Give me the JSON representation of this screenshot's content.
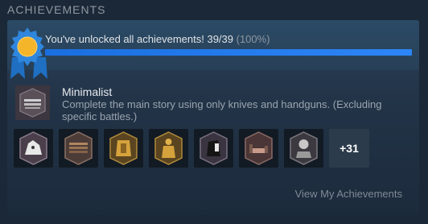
{
  "section": {
    "title": "ACHIEVEMENTS"
  },
  "progress": {
    "text": "You've unlocked all achievements! 39/39",
    "percent_label": "(100%)",
    "unlocked": 39,
    "total": 39,
    "fraction": 1.0,
    "bar_color": "#2d86f7"
  },
  "featured": {
    "name": "Minimalist",
    "description": "Complete the main story using only knives and handguns. (Excluding specific battles.)",
    "icon": "achievement-icon"
  },
  "achievements": {
    "icons": [
      "wolf-achievement-icon",
      "weapons-achievement-icon",
      "gold-armor-achievement-icon",
      "gold-figure-achievement-icon",
      "dark-figure-achievement-icon",
      "bed-achievement-icon",
      "portrait-achievement-icon"
    ],
    "more_label": "+31"
  },
  "footer": {
    "link_label": "View My Achievements"
  },
  "colors": {
    "background": "#1b2838",
    "medal_blue": "#2f86dd",
    "medal_gold": "#f5b52a"
  }
}
